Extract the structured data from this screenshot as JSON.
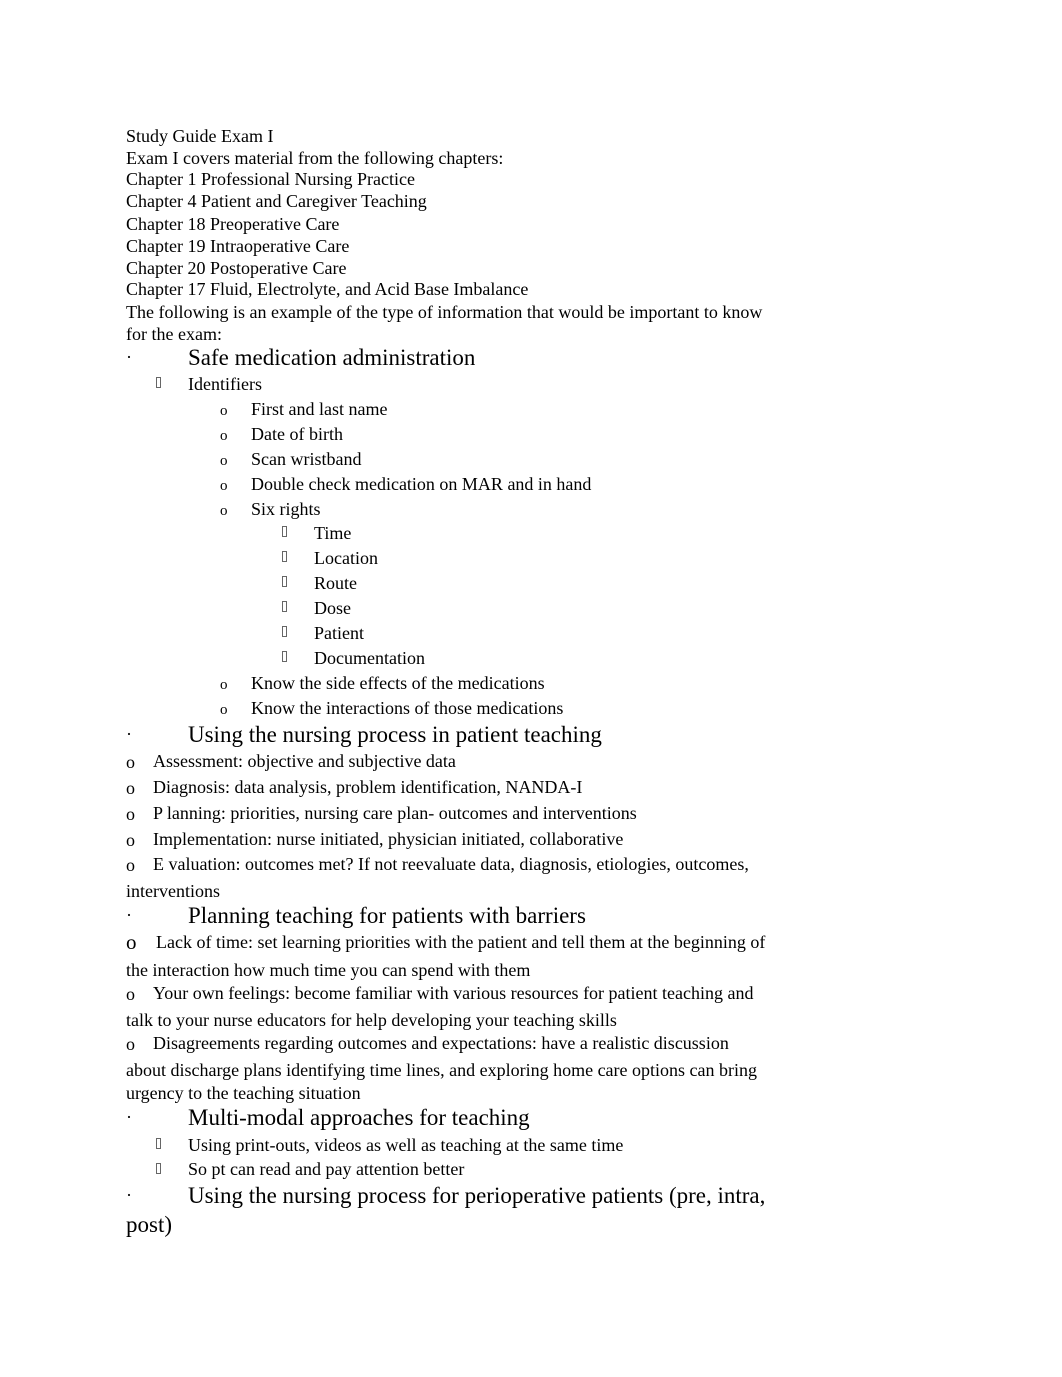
{
  "header": {
    "title": "Study Guide Exam I",
    "intro": "Exam I covers material from the following chapters:"
  },
  "chapters": [
    "Chapter 1 Professional Nursing Practice",
    "Chapter 4 Patient and Caregiver Teaching",
    "Chapter 18 Preoperative Care",
    "Chapter 19 Intraoperative Care",
    "Chapter 20 Postoperative Care",
    "Chapter 17 Fluid, Electrolyte, and Acid Base Imbalance"
  ],
  "note_line1": "The following is an example of the type of information that would be important to know",
  "note_line2": "for the exam:",
  "bullets": {
    "dot": "·",
    "o": "o"
  },
  "sections": {
    "safe_med": {
      "title": "Safe medication administration",
      "identifiers": "Identifiers",
      "items": [
        "First and last name",
        "Date of birth",
        "Scan wristband",
        "Double check medication on MAR and in hand",
        "Six rights"
      ],
      "six_rights": [
        "Time",
        "Location",
        "Route",
        "Dose",
        "Patient",
        "Documentation"
      ],
      "after": [
        "Know the side effects of the medications",
        "Know the interactions of those medications"
      ]
    },
    "nursing_process": {
      "title": "Using the nursing process in patient teaching",
      "items": [
        "Assessment: objective and subjective data",
        "Diagnosis: data analysis, problem identification, NANDA-I",
        "P lanning: priorities, nursing care plan- outcomes and interventions",
        "Implementation: nurse initiated, physician initiated, collaborative",
        "E valuation: outcomes met? If not reevaluate data, diagnosis, etiologies, outcomes,"
      ],
      "wrap": "interventions"
    },
    "barriers": {
      "title": "Planning teaching for patients with barriers",
      "lines": [
        "Lack of time: set learning priorities with the patient and tell them at the beginning of",
        "the interaction how much time you can spend with them",
        "Your own feelings: become familiar with various resources for patient teaching and",
        "talk to your nurse educators for help developing your teaching skills",
        "Disagreements regarding outcomes and expectations: have a realistic discussion",
        "about discharge plans identifying time lines, and exploring home care options can bring",
        "urgency to the teaching situation"
      ]
    },
    "multimodal": {
      "title": "Multi-modal approaches for teaching",
      "items": [
        "Using print-outs, videos as well as teaching at the same time",
        "So pt can read and pay attention better"
      ]
    },
    "perioperative": {
      "title": "Using the nursing process for perioperative patients (pre, intra,",
      "wrap": "post)"
    }
  }
}
